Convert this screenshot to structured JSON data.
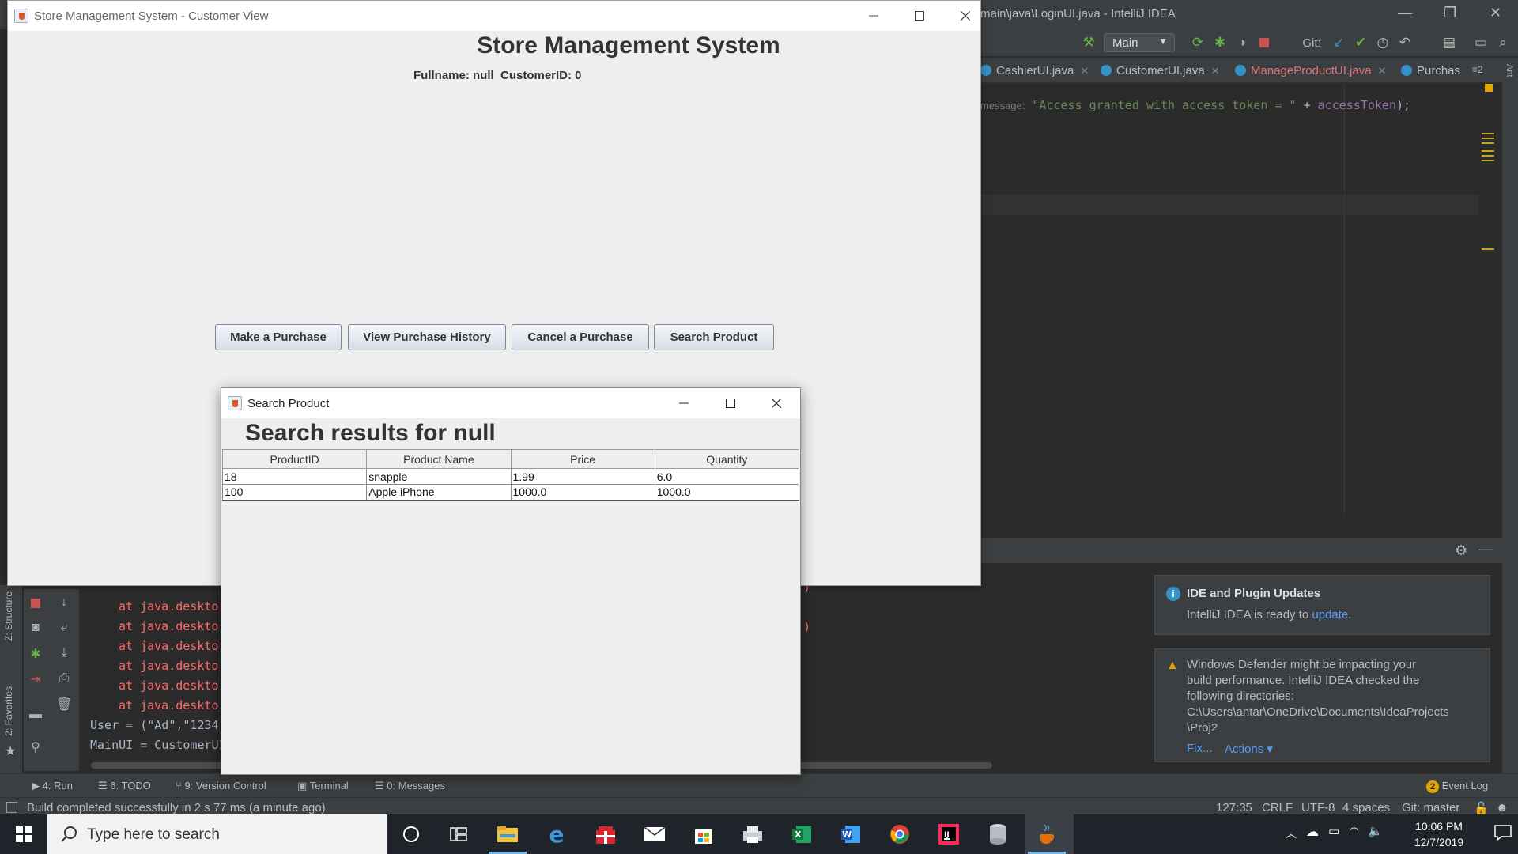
{
  "ide": {
    "title": "main\\java\\LoginUI.java - IntelliJ IDEA",
    "run_config": "Main",
    "git_label": "Git:",
    "editor_tabs": [
      {
        "label": "CashierUI.java"
      },
      {
        "label": "CustomerUI.java"
      },
      {
        "label": "ManageProductUI.java"
      },
      {
        "label": "Purchas"
      }
    ],
    "tabs_overflow": "≡2",
    "code": {
      "hint": "message:",
      "string": "\"Access granted with access token = \"",
      "plus": " + ",
      "ident": "accessToken",
      "end": ");"
    },
    "console_lines": [
      {
        "text": "at java.deskto",
        "kind": "err"
      },
      {
        "text": "at java.deskto",
        "kind": "err"
      },
      {
        "text": "at java.deskto",
        "kind": "err"
      },
      {
        "text": "at java.deskto",
        "kind": "err"
      },
      {
        "text": "at java.deskto",
        "kind": "err"
      },
      {
        "text": "at java.deskto",
        "kind": "err"
      },
      {
        "text": "User = (\"Ad\",\"1234\"",
        "kind": "out"
      },
      {
        "text": "MainUI = CustomerUI",
        "kind": "out"
      }
    ],
    "notifications": {
      "updates": {
        "title": "IDE and Plugin Updates",
        "body": "IntelliJ IDEA is ready to ",
        "link": "update",
        "tail": "."
      },
      "defender": {
        "lines": [
          "Windows Defender might be impacting your",
          "build performance. IntelliJ IDEA checked the",
          "following directories:",
          "C:\\Users\\antar\\OneDrive\\Documents\\IdeaProjects",
          "\\Proj2"
        ],
        "fix": "Fix...",
        "actions": "Actions ▾"
      }
    },
    "bottom_tabs": [
      "4: Run",
      "6: TODO",
      "9: Version Control",
      "Terminal",
      "0: Messages"
    ],
    "event_log": "Event Log",
    "event_count": "2",
    "side_labels": {
      "structure": "Z: Structure",
      "favorites": "2: Favorites",
      "ant": "Ant"
    },
    "status": {
      "message": "Build completed successfully in 2 s 77 ms (a minute ago)",
      "position": "127:35",
      "line_sep": "CRLF",
      "encoding": "UTF-8",
      "indent": "4 spaces",
      "vcs": "Git: master"
    }
  },
  "customer_window": {
    "title": "Store Management System - Customer View",
    "heading": "Store Management System",
    "user_line": "Fullname: null  CustomerID: 0",
    "buttons": {
      "make_purchase": "Make a Purchase",
      "view_history": "View Purchase History",
      "cancel_purchase": "Cancel a Purchase",
      "search_product": "Search Product"
    }
  },
  "search_window": {
    "title": "Search Product",
    "heading": "Search results for null",
    "columns": [
      "ProductID",
      "Product Name",
      "Price",
      "Quantity"
    ],
    "rows": [
      [
        "18",
        "snapple",
        "1.99",
        "6.0"
      ],
      [
        "100",
        "Apple iPhone",
        "1000.0",
        "1000.0"
      ]
    ]
  },
  "taskbar": {
    "search_placeholder": "Type here to search",
    "time": "10:06 PM",
    "date": "12/7/2019"
  },
  "colors": {
    "ide_bg": "#2b2b2b",
    "ide_panel": "#3c3f41",
    "link": "#589df6",
    "error_text": "#ff6b68",
    "window_bg": "#eeeeee",
    "taskbar": "#1f242b"
  }
}
